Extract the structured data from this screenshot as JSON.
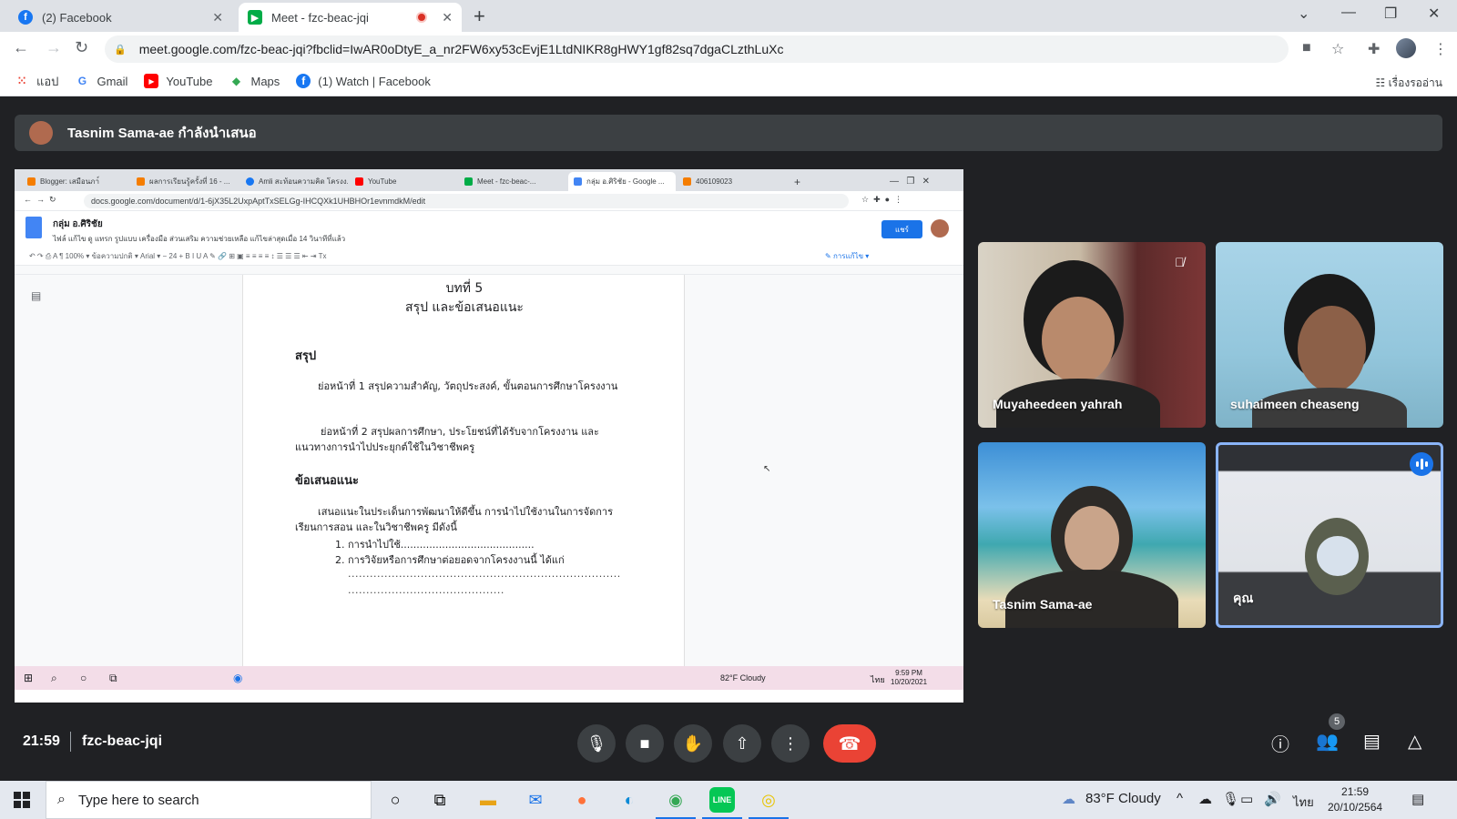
{
  "browser": {
    "tabs": [
      {
        "title": "(2) Facebook",
        "active": false
      },
      {
        "title": "Meet - fzc-beac-jqi",
        "active": true,
        "recording": true
      }
    ],
    "url": "meet.google.com/fzc-beac-jqi?fbclid=IwAR0oDtyE_a_nr2FW6xy53cEvjE1LtdNIKR8gHWY1gf82sq7dgaCLzthLuXc",
    "bookmarks": [
      "แอป",
      "Gmail",
      "YouTube",
      "Maps",
      "(1) Watch | Facebook"
    ],
    "reading_list": "เรื่องรออ่าน"
  },
  "presenter": {
    "text": "Tasnim Sama-ae กำลังนำเสนอ"
  },
  "shared_screen": {
    "tabs": [
      "Blogger: เสมือนภา์",
      "ผลการเรียนรู้ครั้งที่ 16 - ...",
      "Amli สะท้อนความคิด โครงง...",
      "YouTube",
      "Meet - fzc-beac-...",
      "กลุ่ม อ.ศิริชัย - Google ...",
      "406109023"
    ],
    "url": "docs.google.com/document/d/1-6jX35L2UxpAptTxSELGg-IHCQXk1UHBHOr1evnmdkM/edit",
    "doc_title": "กลุ่ม อ.ศิริชัย",
    "menu": "ไฟล์   แก้ไข   ดู   แทรก   รูปแบบ   เครื่องมือ   ส่วนเสริม   ความช่วยเหลือ   แก้ไขล่าสุดเมื่อ 14 วินาทีที่แล้ว",
    "share_label": "แชร์",
    "format_toolbar": "↶  ↷  ⎙  A  ¶   100% ▾   ข้อความปกติ ▾   Arial ▾   −  24  +   B   I   U   A   ✎   🔗  ⊞  ▣   ≡  ≡  ≡  ≡   ↕   ☰  ☰  ☰   ⇤  ⇥   Tx",
    "editing_mode": "การแก้ไข",
    "content": {
      "chapter": "บทที่ 5",
      "chapter_title": "สรุป และข้อเสนอแนะ",
      "section1": "สรุป",
      "para1": "ย่อหน้าที่ 1 สรุปความสำคัญ, วัตถุประสงค์, ขั้นตอนการศึกษาโครงงาน",
      "para2": "ย่อหน้าที่ 2 สรุปผลการศึกษา, ประโยชน์ที่ได้รับจากโครงงาน และแนวทางการนำไปประยุกต์ใช้ในวิชาชีพครู",
      "section2": "ข้อเสนอแนะ",
      "para3": "เสนอแนะในประเด็นการพัฒนาให้ดีขึ้น การนำไปใช้งานในการจัดการเรียนการสอน และในวิชาชีพครู มีดังนี้",
      "item1": "1. การนำไปใช้..........................................",
      "item2": "2. การวิจัยหรือการศึกษาต่อยอดจากโครงงานนี้ ได้แก่",
      "dots1": "...........................................................................",
      "dots2": "..........................................."
    },
    "taskbar": {
      "weather": "82°F  Cloudy",
      "lang": "ไทย",
      "time": "9:59 PM",
      "date": "10/20/2021"
    }
  },
  "participants": [
    {
      "name": "Muyaheedeen yahrah",
      "muted": true
    },
    {
      "name": "suhaimeen cheaseng",
      "muted": false
    },
    {
      "name": "Tasnim Sama-ae",
      "muted": false
    },
    {
      "name": "คุณ",
      "speaking": true
    }
  ],
  "meeting": {
    "time": "21:59",
    "code": "fzc-beac-jqi",
    "participant_count": "5"
  },
  "taskbar": {
    "search_placeholder": "Type here to search",
    "weather": "83°F  Cloudy",
    "lang": "ไทย",
    "time": "21:59",
    "date": "20/10/2564"
  }
}
